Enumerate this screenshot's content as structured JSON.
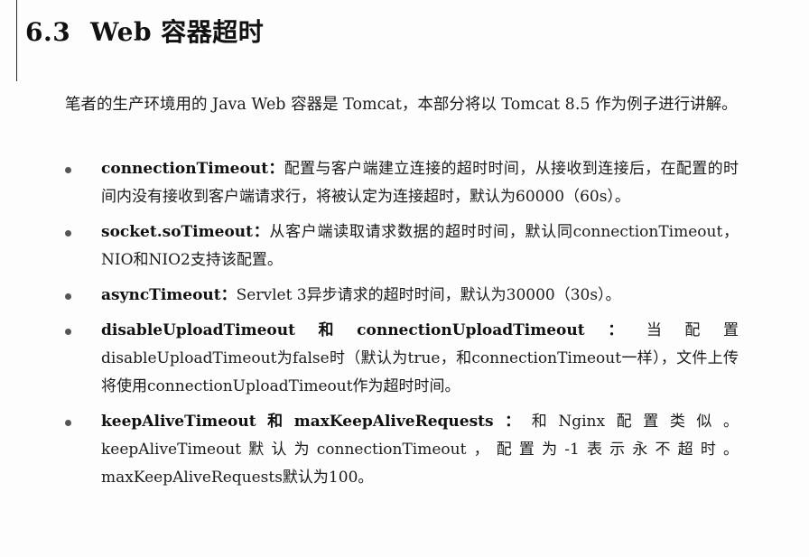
{
  "section": {
    "number": "6.3",
    "title": "Web 容器超时"
  },
  "intro": "笔者的生产环境用的 Java Web 容器是 Tomcat，本部分将以 Tomcat 8.5 作为例子进行讲解。",
  "items": [
    {
      "term": "connectionTimeout",
      "separator": "：",
      "text": "配置与客户端建立连接的超时时间，从接收到连接后，在配置的时间内没有接收到客户端请求行，将被认定为连接超时，默认为60000（60s）。"
    },
    {
      "term": "socket.soTimeout",
      "separator": "：",
      "text": "从客户端读取请求数据的超时时间，默认同connectionTimeout，NIO和NIO2支持该配置。"
    },
    {
      "term": "asyncTimeout",
      "separator": "：",
      "text": "Servlet 3异步请求的超时时间，默认为30000（30s）。"
    },
    {
      "term": "disableUploadTimeout和connectionUploadTimeout",
      "separator": "：",
      "text": "当配置disableUploadTimeout为false时（默认为true，和connectionTimeout一样），文件上传将使用connectionUploadTimeout作为超时时间。"
    },
    {
      "term": "keepAliveTimeout和maxKeepAliveRequests",
      "separator": "：",
      "text": "和Nginx配置类似。keepAliveTimeout默认为connectionTimeout，配置为-1表示永不超时。maxKeepAliveRequests默认为100。"
    }
  ]
}
